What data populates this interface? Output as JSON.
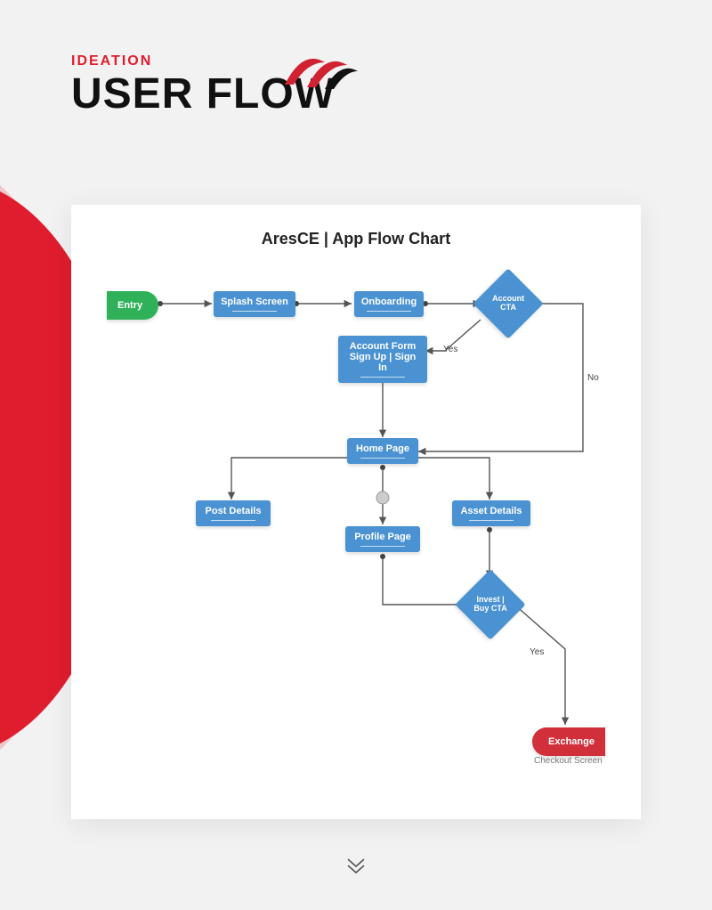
{
  "header": {
    "subtitle": "IDEATION",
    "title": "USER FLOW"
  },
  "chart": {
    "title": "AresCE | App Flow Chart",
    "nodes": {
      "entry": "Entry",
      "splash": "Splash Screen",
      "onboarding": "Onboarding",
      "accountCTA": "Account CTA",
      "accountForm": "Account Form Sign Up | Sign In",
      "home": "Home Page",
      "postDetails": "Post Details",
      "profile": "Profile Page",
      "assetDetails": "Asset Details",
      "investCTA": "Invest | Buy CTA",
      "exchange": "Exchange"
    },
    "labels": {
      "yes1": "Yes",
      "no": "No",
      "yes2": "Yes"
    },
    "caption": "Checkout Screen"
  },
  "chart_data": {
    "type": "flowchart",
    "title": "AresCE | App Flow Chart",
    "nodes": [
      {
        "id": "entry",
        "label": "Entry",
        "type": "start"
      },
      {
        "id": "splash",
        "label": "Splash Screen",
        "type": "process"
      },
      {
        "id": "onboarding",
        "label": "Onboarding",
        "type": "process"
      },
      {
        "id": "accountCTA",
        "label": "Account CTA",
        "type": "decision"
      },
      {
        "id": "accountForm",
        "label": "Account Form Sign Up | Sign In",
        "type": "process"
      },
      {
        "id": "home",
        "label": "Home Page",
        "type": "process"
      },
      {
        "id": "postDetails",
        "label": "Post Details",
        "type": "process"
      },
      {
        "id": "profile",
        "label": "Profile Page",
        "type": "process"
      },
      {
        "id": "assetDetails",
        "label": "Asset Details",
        "type": "process"
      },
      {
        "id": "investCTA",
        "label": "Invest | Buy CTA",
        "type": "decision"
      },
      {
        "id": "exchange",
        "label": "Exchange",
        "type": "end",
        "caption": "Checkout Screen"
      }
    ],
    "edges": [
      {
        "from": "entry",
        "to": "splash"
      },
      {
        "from": "splash",
        "to": "onboarding"
      },
      {
        "from": "onboarding",
        "to": "accountCTA"
      },
      {
        "from": "accountCTA",
        "to": "accountForm",
        "label": "Yes"
      },
      {
        "from": "accountCTA",
        "to": "home",
        "label": "No"
      },
      {
        "from": "accountForm",
        "to": "home"
      },
      {
        "from": "home",
        "to": "postDetails"
      },
      {
        "from": "home",
        "to": "profile"
      },
      {
        "from": "home",
        "to": "assetDetails"
      },
      {
        "from": "profile",
        "to": "investCTA"
      },
      {
        "from": "assetDetails",
        "to": "investCTA"
      },
      {
        "from": "investCTA",
        "to": "exchange",
        "label": "Yes"
      }
    ]
  }
}
